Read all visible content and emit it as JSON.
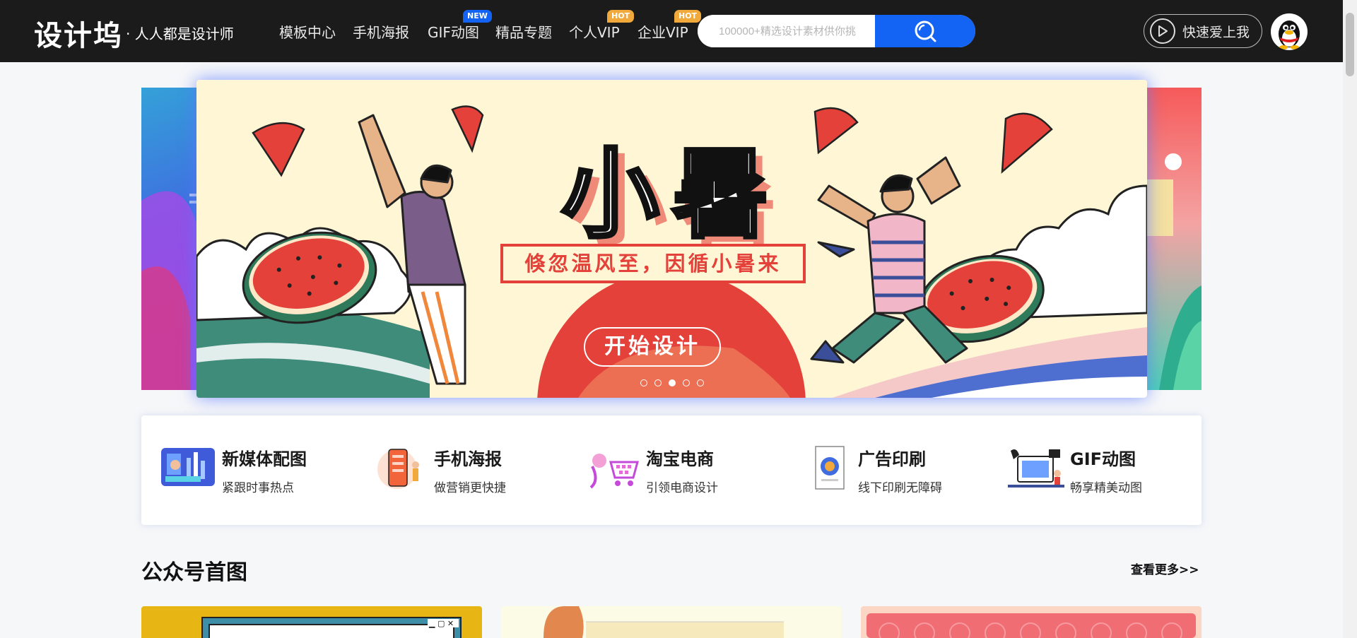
{
  "header": {
    "logo": "设计坞",
    "slogan": "· 人人都是设计师",
    "nav": [
      {
        "label": "模板中心"
      },
      {
        "label": "手机海报"
      },
      {
        "label": "GIF动图",
        "badge": "NEW"
      },
      {
        "label": "精品专题"
      },
      {
        "label": "个人VIP",
        "badge": "HOT"
      },
      {
        "label": "企业VIP",
        "badge": "HOT"
      }
    ],
    "search_placeholder": "100000+精选设计素材供你挑",
    "love_button": "快速爱上我"
  },
  "banner": {
    "title": "小暑",
    "subtitle": "倏忽温风至，因循小暑来",
    "cta": "开始设计",
    "slide_count": 5,
    "active_slide": 3
  },
  "categories": [
    {
      "title": "新媒体配图",
      "desc": "紧跟时事热点"
    },
    {
      "title": "手机海报",
      "desc": "做营销更快捷"
    },
    {
      "title": "淘宝电商",
      "desc": "引领电商设计"
    },
    {
      "title": "广告印刷",
      "desc": "线下印刷无障碍"
    },
    {
      "title": "GIF动图",
      "desc": "畅享精美动图"
    }
  ],
  "section": {
    "title": "公众号首图",
    "more": "查看更多>>"
  },
  "colors": {
    "header_bg": "#1b1b1b",
    "accent_blue": "#1363f5",
    "badge_new": "#1363f5",
    "badge_hot": "#f0a93a",
    "banner_bg": "#fef6d5",
    "banner_red": "#e3413a"
  }
}
